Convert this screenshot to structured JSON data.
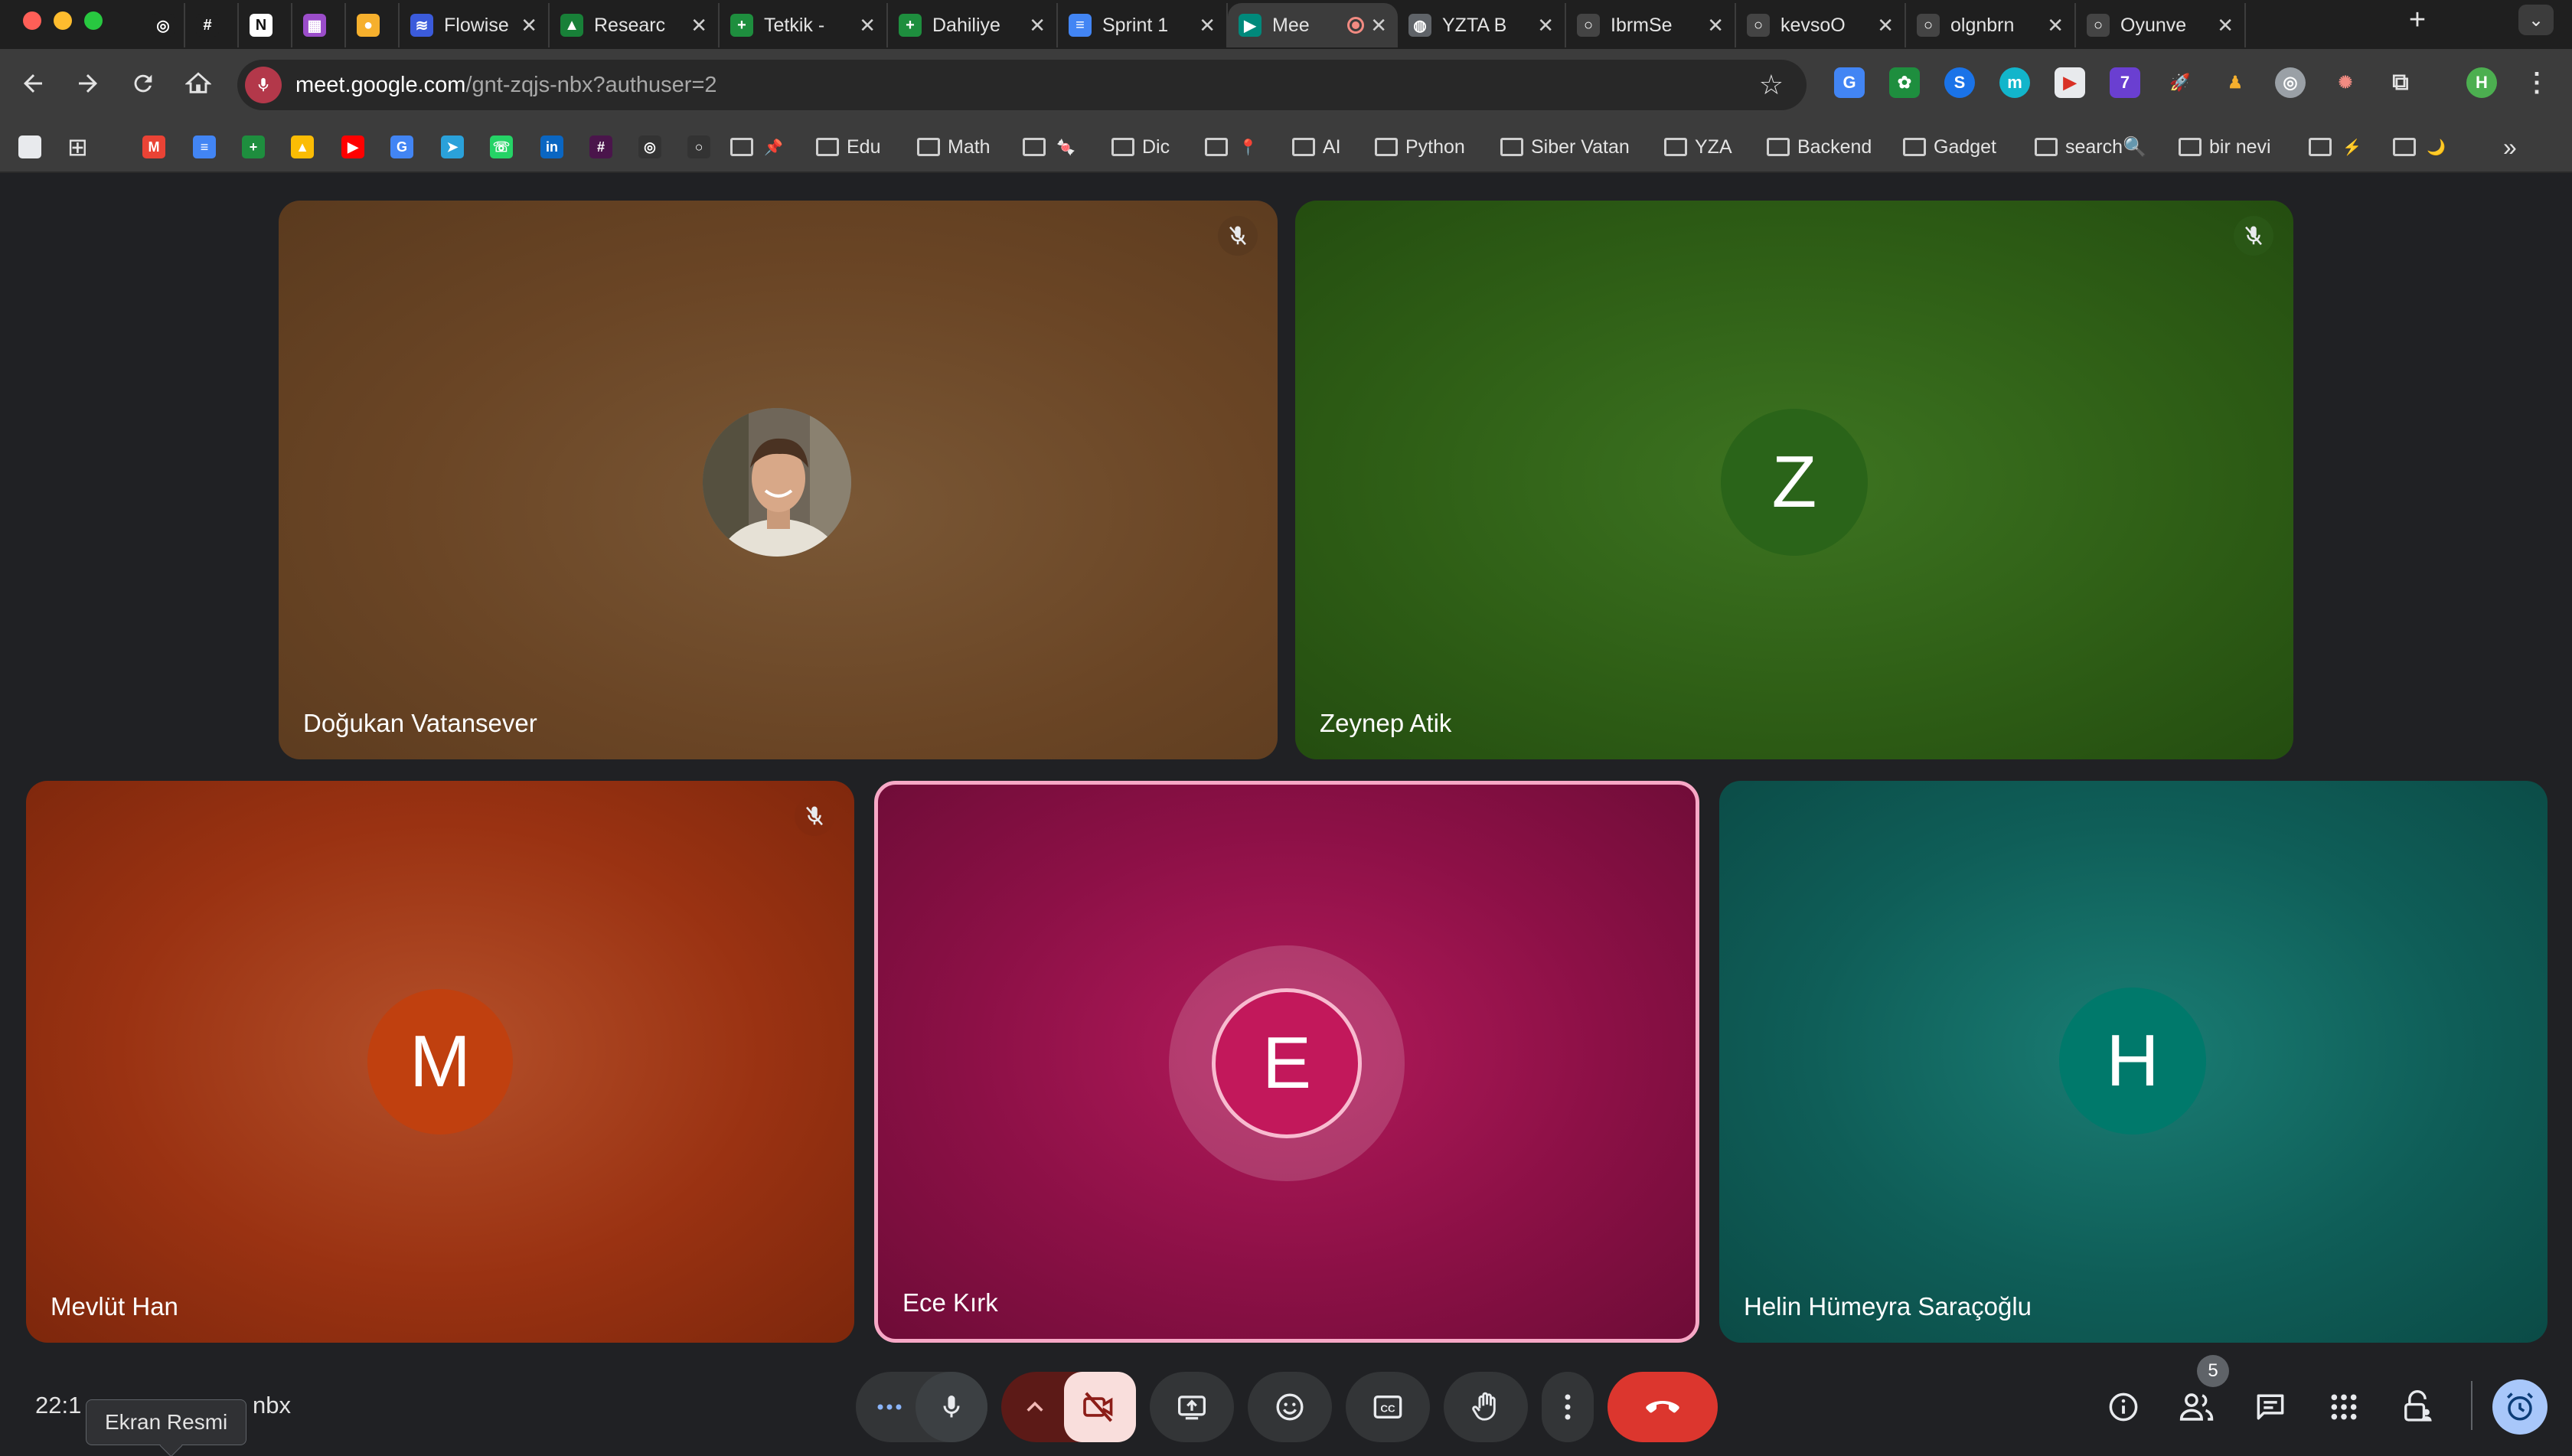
{
  "browser": {
    "tabs": [
      {
        "label": "",
        "favicon_icon": "openai-icon",
        "color": "#1f1f1f"
      },
      {
        "label": "",
        "favicon_icon": "slack-icon",
        "color": "#1f1f1f"
      },
      {
        "label": "",
        "favicon_icon": "notion-icon",
        "color": "#ffffff"
      },
      {
        "label": "",
        "favicon_icon": "calendar-icon",
        "color": "#9b4dca"
      },
      {
        "label": "",
        "favicon_icon": "sun-icon",
        "color": "#f6b02d"
      },
      {
        "label": "Flowise",
        "favicon_icon": "flowise-icon",
        "color": "#3b5bdb"
      },
      {
        "label": "Researc",
        "favicon_icon": "google-drive-icon",
        "color": "#188038"
      },
      {
        "label": "Tetkik -",
        "favicon_icon": "google-sheets-icon",
        "color": "#1e8e3e"
      },
      {
        "label": "Dahiliye",
        "favicon_icon": "google-sheets-icon",
        "color": "#1e8e3e"
      },
      {
        "label": "Sprint 1",
        "favicon_icon": "google-docs-icon",
        "color": "#4285f4"
      },
      {
        "label": "Mee",
        "favicon_icon": "google-meet-icon",
        "color": "#00897b",
        "active": true
      },
      {
        "label": "YZTA B",
        "favicon_icon": "globe-icon",
        "color": "#5f6368"
      },
      {
        "label": "IbrmSe",
        "favicon_icon": "github-icon",
        "color": "#444"
      },
      {
        "label": "kevsoO",
        "favicon_icon": "github-icon",
        "color": "#444"
      },
      {
        "label": "olgnbrn",
        "favicon_icon": "github-icon",
        "color": "#444"
      },
      {
        "label": "Oyunve",
        "favicon_icon": "github-icon",
        "color": "#444"
      }
    ],
    "url_host": "meet.google.com",
    "url_path": "/gnt-zqjs-nbx?authuser=2",
    "profile_initial": "H",
    "bookmarks": [
      {
        "type": "icon",
        "icon": "gmail-icon",
        "color": "#ea4335",
        "glyph": "M"
      },
      {
        "type": "icon",
        "icon": "google-docs-icon",
        "color": "#4285f4",
        "glyph": "≡"
      },
      {
        "type": "icon",
        "icon": "google-sheets-icon",
        "color": "#1e8e3e",
        "glyph": "+"
      },
      {
        "type": "icon",
        "icon": "google-drive-icon",
        "color": "#fbbc04",
        "glyph": "▲"
      },
      {
        "type": "icon",
        "icon": "youtube-icon",
        "color": "#ff0000",
        "glyph": "▶"
      },
      {
        "type": "icon",
        "icon": "google-translate-icon",
        "color": "#4285f4",
        "glyph": "G"
      },
      {
        "type": "icon",
        "icon": "telegram-icon",
        "color": "#2aa1da",
        "glyph": "➤"
      },
      {
        "type": "icon",
        "icon": "whatsapp-icon",
        "color": "#25d366",
        "glyph": "☏"
      },
      {
        "type": "icon",
        "icon": "linkedin-icon",
        "color": "#0a66c2",
        "glyph": "in"
      },
      {
        "type": "icon",
        "icon": "slack-icon",
        "color": "#4a154b",
        "glyph": "#"
      },
      {
        "type": "icon",
        "icon": "openai-icon",
        "color": "#333",
        "glyph": "◎"
      },
      {
        "type": "icon",
        "icon": "github-icon",
        "color": "#333",
        "glyph": "○"
      },
      {
        "type": "folder",
        "label": "",
        "emoji": "📌"
      },
      {
        "type": "folder",
        "label": "Edu"
      },
      {
        "type": "folder",
        "label": "Math"
      },
      {
        "type": "folder",
        "label": "",
        "emoji": "🍬"
      },
      {
        "type": "folder",
        "label": "Dic"
      },
      {
        "type": "folder",
        "label": "",
        "emoji": "📍"
      },
      {
        "type": "folder",
        "label": "AI"
      },
      {
        "type": "folder",
        "label": "Python"
      },
      {
        "type": "folder",
        "label": "Siber Vatan"
      },
      {
        "type": "folder",
        "label": "YZA"
      },
      {
        "type": "folder",
        "label": "Backend"
      },
      {
        "type": "folder",
        "label": "Gadget"
      },
      {
        "type": "folder",
        "label": "search🔍"
      },
      {
        "type": "folder",
        "label": "bir nevi"
      },
      {
        "type": "folder",
        "label": "",
        "emoji": "⚡"
      },
      {
        "type": "folder",
        "label": "",
        "emoji": "🌙"
      }
    ]
  },
  "meet": {
    "participants": [
      {
        "name": "Doğukan Vatansever",
        "avatar": "photo",
        "muted": true,
        "bg": "#6b4a2b"
      },
      {
        "name": "Zeynep Atik",
        "avatar_letter": "Z",
        "muted": true,
        "bg": "#2f5f16"
      },
      {
        "name": "Mevlüt Han",
        "avatar_letter": "M",
        "muted": true,
        "bg": "#9a3212"
      },
      {
        "name": "Ece Kırk",
        "avatar_letter": "E",
        "muted": false,
        "speaking": true,
        "bg": "#8c1046"
      },
      {
        "name": "Helin Hümeyra Saraçoğlu",
        "avatar_letter": "H",
        "muted": false,
        "bg": "#0f5e58"
      }
    ],
    "clock": "22:1",
    "meeting_code_tail": "nbx",
    "tooltip": "Ekran Resmi",
    "participant_count": "5"
  }
}
